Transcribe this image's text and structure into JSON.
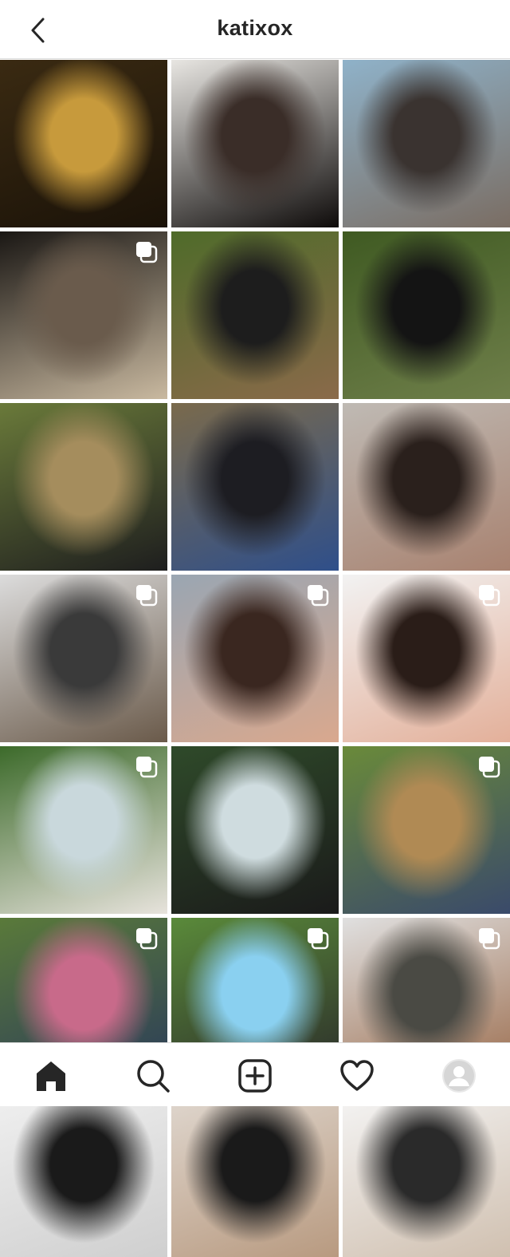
{
  "header": {
    "username": "katixox",
    "back_icon": "chevron-left-icon"
  },
  "grid": {
    "tiles": [
      {
        "name": "post-christmas-tree",
        "colors": [
          "#3a2a12",
          "#c79a3c",
          "#1a1208"
        ],
        "multi": false
      },
      {
        "name": "post-portrait-dark-hair",
        "colors": [
          "#e8e6e2",
          "#3a2d28",
          "#0e0b0a"
        ],
        "multi": false
      },
      {
        "name": "post-beach-rocks",
        "colors": [
          "#8fb2c9",
          "#3a3330",
          "#7a6d63"
        ],
        "multi": false
      },
      {
        "name": "post-night-beach-blanket",
        "colors": [
          "#1a1714",
          "#6a5b4c",
          "#c9b9a0"
        ],
        "multi": true
      },
      {
        "name": "post-forest-pink-beanie",
        "colors": [
          "#4f6b2a",
          "#1d1d1d",
          "#8a6a4a"
        ],
        "multi": false
      },
      {
        "name": "post-forest-hands-on-head",
        "colors": [
          "#3f5a22",
          "#141414",
          "#6f7f4a"
        ],
        "multi": false
      },
      {
        "name": "post-woodland-path",
        "colors": [
          "#6a7a3a",
          "#a58d5d",
          "#1e1e1e"
        ],
        "multi": false
      },
      {
        "name": "post-sitting-jeans",
        "colors": [
          "#7a6a4c",
          "#1d1d22",
          "#2f4f8a"
        ],
        "multi": false
      },
      {
        "name": "post-mirror-tattoo",
        "colors": [
          "#bfbab4",
          "#2a201c",
          "#a88270"
        ],
        "multi": false
      },
      {
        "name": "post-sofa-blanket",
        "colors": [
          "#dcdcdc",
          "#3a3a3a",
          "#6a5a4a"
        ],
        "multi": true
      },
      {
        "name": "post-selfie-smile",
        "colors": [
          "#9aa6b2",
          "#3a2720",
          "#d9a88e"
        ],
        "multi": true
      },
      {
        "name": "post-selfie-wink",
        "colors": [
          "#f2f2f2",
          "#2a1d18",
          "#e3b09a"
        ],
        "multi": true
      },
      {
        "name": "post-hot-tub-sunglasses",
        "colors": [
          "#3c6a2a",
          "#c9d8dc",
          "#e7e3dc"
        ],
        "multi": true
      },
      {
        "name": "post-hot-tub-glass",
        "colors": [
          "#2f4a2a",
          "#cfdcdf",
          "#1a1a1a"
        ],
        "multi": false
      },
      {
        "name": "post-garden-swing",
        "colors": [
          "#6a8a3a",
          "#b08a54",
          "#3a4a6a"
        ],
        "multi": true
      },
      {
        "name": "post-party-friends",
        "colors": [
          "#5a7a3a",
          "#c86a8a",
          "#2a3a5a"
        ],
        "multi": true
      },
      {
        "name": "post-paddling-pool",
        "colors": [
          "#5a8a3a",
          "#8ad0f0",
          "#2a2a2a"
        ],
        "multi": true
      },
      {
        "name": "post-balcony-drink",
        "colors": [
          "#e0e0e0",
          "#4a4a44",
          "#9a6a4a"
        ],
        "multi": true
      },
      {
        "name": "post-partial-row-1",
        "colors": [
          "#f0f0f0",
          "#1a1a1a",
          "#cfcfcf"
        ],
        "multi": false
      },
      {
        "name": "post-partial-row-2",
        "colors": [
          "#e0d8d0",
          "#1a1a1a",
          "#b89a80"
        ],
        "multi": false
      },
      {
        "name": "post-partial-row-3",
        "colors": [
          "#f5f5f5",
          "#2a2a2a",
          "#d0c0b0"
        ],
        "multi": false
      }
    ]
  },
  "bottom_nav": {
    "items": [
      {
        "name": "home",
        "icon": "home-icon",
        "active": true
      },
      {
        "name": "search",
        "icon": "search-icon",
        "active": false
      },
      {
        "name": "create",
        "icon": "add-post-icon",
        "active": false
      },
      {
        "name": "activity",
        "icon": "heart-icon",
        "active": false
      },
      {
        "name": "profile",
        "icon": "profile-avatar-icon",
        "active": false
      }
    ]
  },
  "colors": {
    "text": "#262626",
    "divider": "#dbdbdb",
    "background": "#ffffff"
  }
}
